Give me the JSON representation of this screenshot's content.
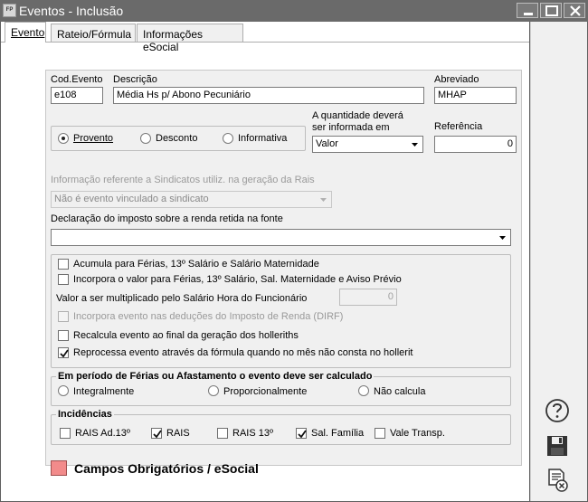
{
  "window": {
    "app_icon_text": "FP",
    "title": "Eventos - Inclusão"
  },
  "tabs": [
    {
      "label": "Evento",
      "active": true
    },
    {
      "label": "Rateio/Fórmula",
      "active": false
    },
    {
      "label": "Informações eSocial",
      "active": false
    }
  ],
  "fields": {
    "cod_evento": {
      "label": "Cod.Evento",
      "value": "e108"
    },
    "descricao": {
      "label": "Descrição",
      "value": "Média Hs p/ Abono Pecuniário"
    },
    "abreviado": {
      "label": "Abreviado",
      "value": "MHAP"
    },
    "quantidade": {
      "label_line1": "A quantidade deverá",
      "label_line2": "ser informada em",
      "value": "Valor"
    },
    "referencia": {
      "label": "Referência",
      "value": "0"
    },
    "sindicato": {
      "label": "Informação referente a Sindicatos utiliz. na geração da Rais",
      "value": "Não é evento vinculado a sindicato"
    },
    "declaracao": {
      "label": "Declaração do imposto sobre a renda retida na fonte",
      "value": ""
    },
    "valor_mult": {
      "label": "Valor a ser multiplicado pelo Salário Hora do Funcionário",
      "value": "0"
    }
  },
  "tipo": {
    "options": [
      {
        "label": "Provento",
        "selected": true
      },
      {
        "label": "Desconto",
        "selected": false
      },
      {
        "label": "Informativa",
        "selected": false
      }
    ]
  },
  "checks": [
    {
      "label": "Acumula para Férias, 13º Salário e Salário Maternidade",
      "checked": false,
      "disabled": false
    },
    {
      "label": "Incorpora o valor para Férias, 13º Salário, Sal. Maternidade e Aviso Prévio",
      "checked": false,
      "disabled": false
    },
    {
      "label": "Incorpora evento nas deduções do Imposto de Renda (DIRF)",
      "checked": false,
      "disabled": true
    },
    {
      "label": "Recalcula evento ao final da geração dos holleriths",
      "checked": false,
      "disabled": false
    },
    {
      "label": "Reprocessa evento através da fórmula quando no mês não consta no hollerit",
      "checked": true,
      "disabled": false
    }
  ],
  "periodo": {
    "title": "Em período de Férias ou Afastamento o evento deve ser calculado",
    "options": [
      {
        "label": "Integralmente",
        "selected": false
      },
      {
        "label": "Proporcionalmente",
        "selected": false
      },
      {
        "label": "Não calcula",
        "selected": false
      }
    ]
  },
  "incidencias": {
    "title": "Incidências",
    "items": [
      {
        "label": "RAIS Ad.13º",
        "checked": false
      },
      {
        "label": "RAIS",
        "checked": true
      },
      {
        "label": "RAIS 13º",
        "checked": false
      },
      {
        "label": "Sal. Família",
        "checked": true
      },
      {
        "label": "Vale Transp.",
        "checked": false
      }
    ]
  },
  "legend": {
    "label": "Campos Obrigatórios / eSocial",
    "color": "#f28b8b"
  },
  "sidebar": {
    "icons": [
      "help-icon",
      "save-icon",
      "cancel-document-icon"
    ]
  }
}
